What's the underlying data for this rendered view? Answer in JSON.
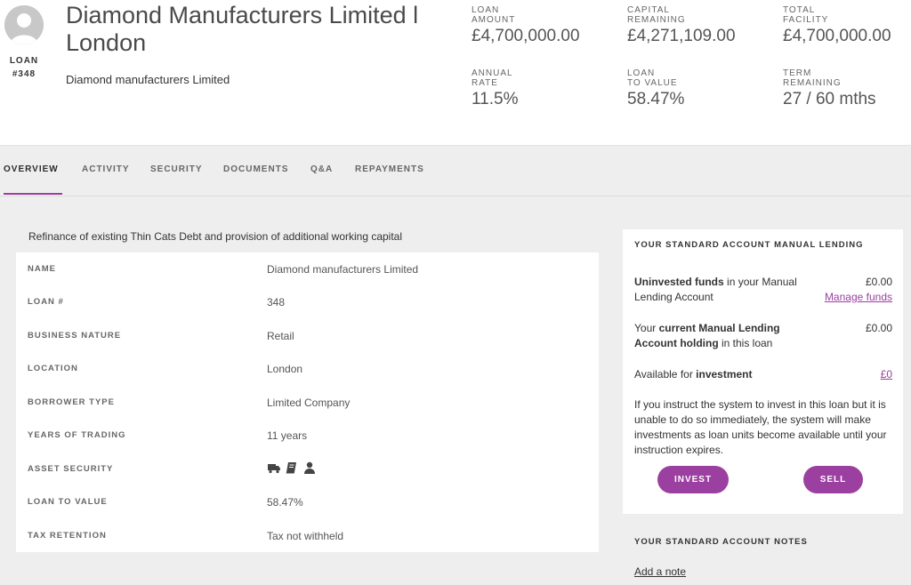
{
  "header": {
    "loan_label": "LOAN",
    "loan_number": "#348",
    "title": "Diamond Manufacturers Limited l London",
    "subtitle": "Diamond manufacturers Limited"
  },
  "stats": [
    {
      "label": "LOAN\nAMOUNT",
      "value": "£4,700,000.00"
    },
    {
      "label": "CAPITAL\nREMAINING",
      "value": "£4,271,109.00"
    },
    {
      "label": "TOTAL\nFACILITY",
      "value": "£4,700,000.00"
    },
    {
      "label": "ANNUAL\nRATE",
      "value": "11.5%"
    },
    {
      "label": "LOAN\nTO VALUE",
      "value": "58.47%"
    },
    {
      "label": "TERM\nREMAINING",
      "value": "27 / 60 mths"
    }
  ],
  "tabs": [
    "OVERVIEW",
    "ACTIVITY",
    "SECURITY",
    "DOCUMENTS",
    "Q&A",
    "REPAYMENTS"
  ],
  "description": "Refinance of existing Thin Cats Debt and provision of additional working capital",
  "details": [
    {
      "key": "NAME",
      "value": "Diamond manufacturers Limited"
    },
    {
      "key": "LOAN #",
      "value": "348"
    },
    {
      "key": "BUSINESS NATURE",
      "value": "Retail"
    },
    {
      "key": "LOCATION",
      "value": "London"
    },
    {
      "key": "BORROWER TYPE",
      "value": "Limited Company"
    },
    {
      "key": "YEARS OF TRADING",
      "value": "11 years"
    },
    {
      "key": "ASSET SECURITY",
      "icons": [
        "truck-icon",
        "book-icon",
        "user-icon"
      ]
    },
    {
      "key": "LOAN TO VALUE",
      "value": "58.47%"
    },
    {
      "key": "TAX RETENTION",
      "value": "Tax not withheld"
    }
  ],
  "side": {
    "title": "YOUR STANDARD ACCOUNT MANUAL LENDING",
    "uninvested_bold": "Uninvested funds",
    "uninvested_rest": " in your Manual Lending Account",
    "uninvested_value": "£0.00",
    "manage_funds": "Manage funds",
    "holding_pre": "Your ",
    "holding_bold": "current Manual Lending Account holding",
    "holding_post": " in this loan",
    "holding_value": "£0.00",
    "available_pre": "Available for ",
    "available_bold": "investment",
    "available_value": "£0",
    "note": "If you instruct the system to invest in this loan but it is unable to do so immediately, the system will make investments as loan units become available until your instruction expires.",
    "invest_label": "INVEST",
    "sell_label": "SELL"
  },
  "notes": {
    "title": "YOUR STANDARD ACCOUNT NOTES",
    "add_note": "Add a note"
  },
  "colors": {
    "accent": "#9b3fa0",
    "background": "#efeeee",
    "panel": "#ffffff"
  }
}
